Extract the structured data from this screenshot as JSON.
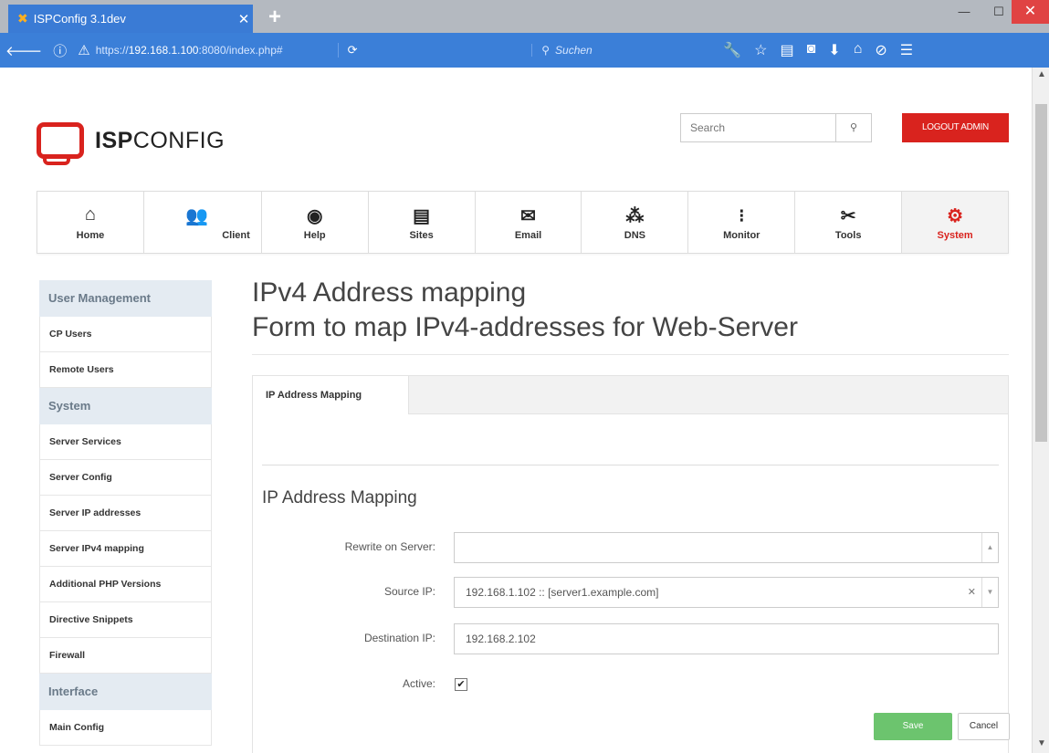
{
  "browser": {
    "tab_title": "ISPConfig 3.1dev",
    "tab_close": "✕",
    "new_tab": "+",
    "win_min": "—",
    "win_max": "☐",
    "win_close": "✕",
    "url_prefix": "https://",
    "url_host": "192.168.1.100",
    "url_suffix": ":8080/index.php#",
    "search_placeholder": "Suchen"
  },
  "header": {
    "logo_bold": "ISP",
    "logo_light": "CONFIG",
    "search_placeholder": "Search",
    "logout_label": "LOGOUT ADMIN"
  },
  "nav": {
    "items": [
      {
        "label": "Home",
        "icon": "home-icon"
      },
      {
        "label": "Client",
        "icon": "users-icon"
      },
      {
        "label": "Help",
        "icon": "lifebuoy-icon"
      },
      {
        "label": "Sites",
        "icon": "window-icon"
      },
      {
        "label": "Email",
        "icon": "envelope-icon"
      },
      {
        "label": "DNS",
        "icon": "network-icon"
      },
      {
        "label": "Monitor",
        "icon": "traffic-icon"
      },
      {
        "label": "Tools",
        "icon": "tools-icon"
      },
      {
        "label": "System",
        "icon": "gear-icon"
      }
    ],
    "active": "System"
  },
  "sidebar": {
    "group1": "User Management",
    "items1": [
      "CP Users",
      "Remote Users"
    ],
    "group2": "System",
    "items2": [
      "Server Services",
      "Server Config",
      "Server IP addresses",
      "Server IPv4 mapping",
      "Additional PHP Versions",
      "Directive Snippets",
      "Firewall"
    ],
    "group3": "Interface",
    "items3": [
      "Main Config"
    ]
  },
  "main": {
    "title": "IPv4 Address mapping",
    "subtitle": "Form to map IPv4-addresses for Web-Server",
    "tab_label": "IP Address Mapping",
    "section_title": "IP Address Mapping",
    "fields": {
      "rewrite_label": "Rewrite on Server:",
      "rewrite_value": "",
      "source_label": "Source IP:",
      "source_value": "192.168.1.102 :: [server1.example.com]",
      "dest_label": "Destination IP:",
      "dest_value": "192.168.2.102",
      "active_label": "Active:",
      "active_checked": true
    },
    "save_label": "Save",
    "cancel_label": "Cancel"
  },
  "colors": {
    "brand_red": "#d9231e",
    "save_green": "#6cc46e",
    "browser_blue": "#3b7fd8"
  }
}
